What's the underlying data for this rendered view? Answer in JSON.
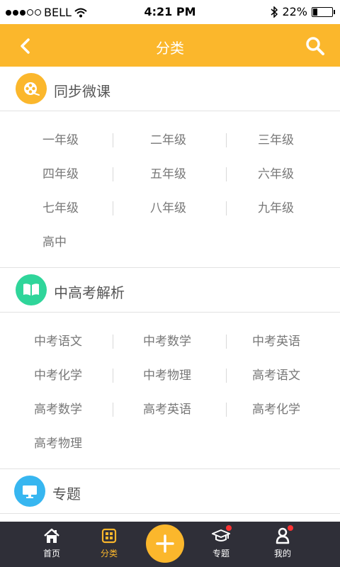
{
  "status_bar": {
    "carrier": "BELL",
    "time": "4:21 PM",
    "battery": "22%",
    "battery_level": 0.22
  },
  "nav": {
    "title": "分类"
  },
  "sections": [
    {
      "title": "同步微课",
      "icon": "film-reel-icon",
      "color": "#fbb72c",
      "items": [
        "一年级",
        "二年级",
        "三年级",
        "四年级",
        "五年级",
        "六年级",
        "七年级",
        "八年级",
        "九年级",
        "高中"
      ]
    },
    {
      "title": "中高考解析",
      "icon": "book-icon",
      "color": "#2fd59a",
      "items": [
        "中考语文",
        "中考数学",
        "中考英语",
        "中考化学",
        "中考物理",
        "高考语文",
        "高考数学",
        "高考英语",
        "高考化学",
        "高考物理"
      ]
    },
    {
      "title": "专题",
      "icon": "monitor-icon",
      "color": "#37b6f0",
      "items": []
    }
  ],
  "tab_bar": {
    "tabs": [
      {
        "label": "首页",
        "icon": "home-icon",
        "active": false,
        "badge": false
      },
      {
        "label": "分类",
        "icon": "category-icon",
        "active": true,
        "badge": false
      },
      {
        "label": "专题",
        "icon": "graduation-cap-icon",
        "active": false,
        "badge": true
      },
      {
        "label": "我的",
        "icon": "person-icon",
        "active": false,
        "badge": true
      }
    ],
    "center_button": "add-icon"
  }
}
